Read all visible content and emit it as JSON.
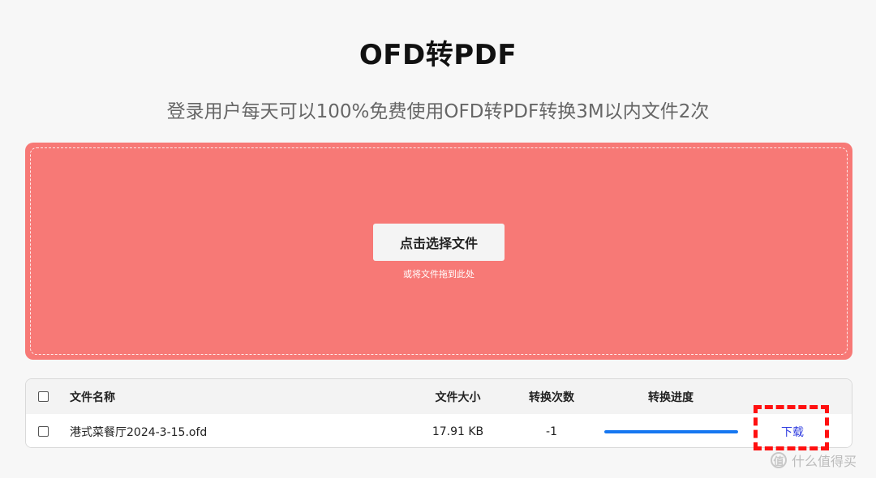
{
  "header": {
    "title": "OFD转PDF",
    "subtitle": "登录用户每天可以100%免费使用OFD转PDF转换3M以内文件2次"
  },
  "upload": {
    "button_label": "点击选择文件",
    "drop_hint": "或将文件拖到此处",
    "background_color": "#f77976"
  },
  "table": {
    "headers": {
      "name": "文件名称",
      "size": "文件大小",
      "count": "转换次数",
      "progress": "转换进度"
    },
    "rows": [
      {
        "name": "港式菜餐厅2024-3-15.ofd",
        "size": "17.91 KB",
        "count": "-1",
        "progress": 1.0,
        "action": "下载"
      }
    ]
  },
  "watermark": {
    "icon": "值",
    "text": "什么值得买"
  },
  "colors": {
    "progress": "#1677f1",
    "download_link": "#2f3ce0",
    "highlight": "#ff1010"
  }
}
